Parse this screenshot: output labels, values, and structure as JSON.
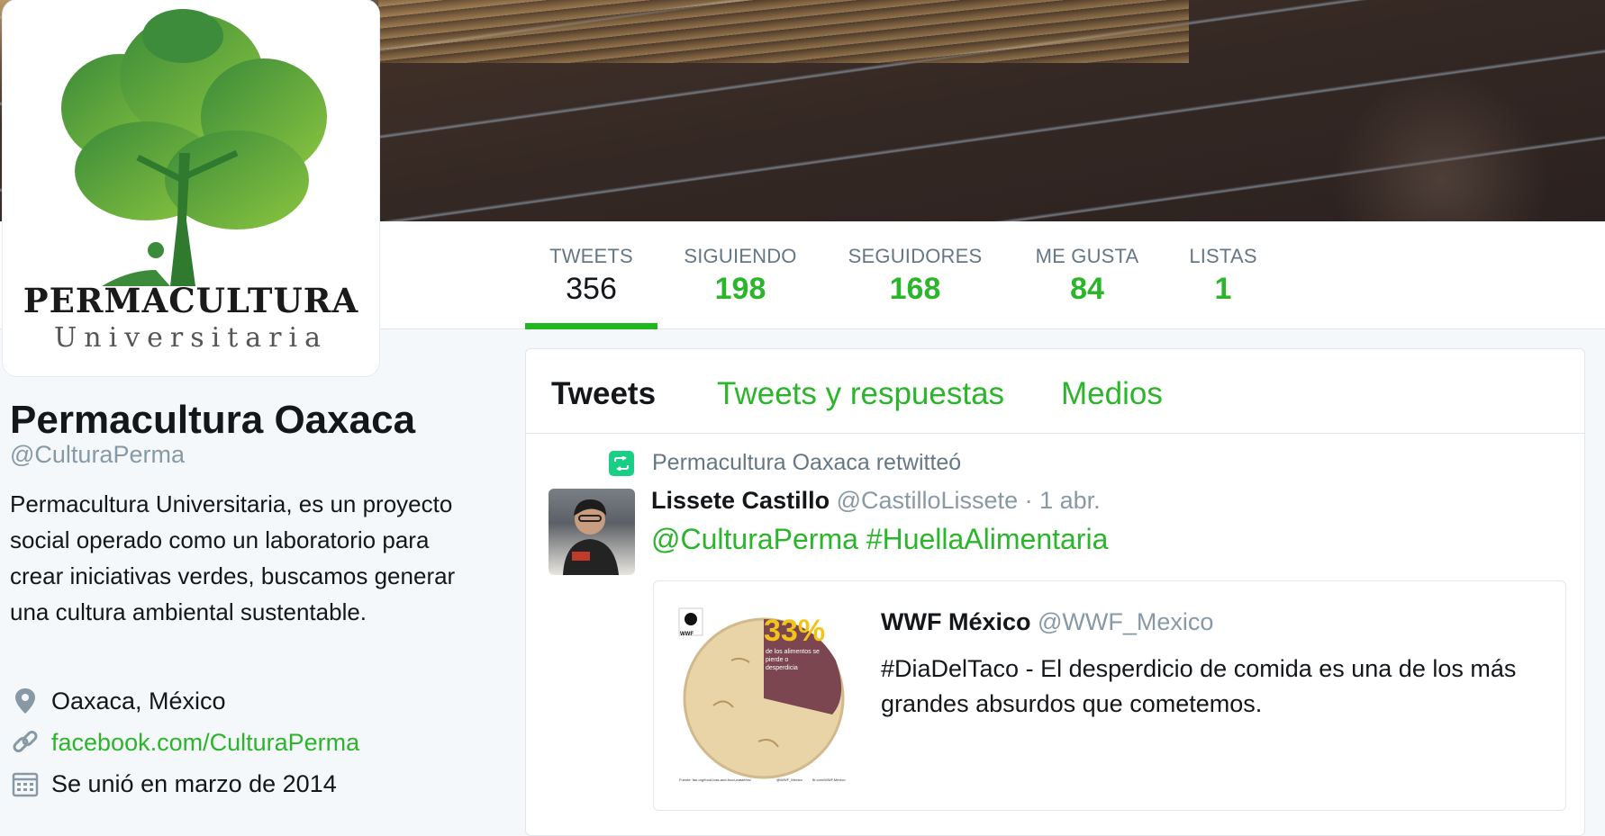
{
  "profile": {
    "logo_title": "PERMACULTURA",
    "logo_subtitle": "Universitaria",
    "name": "Permacultura Oaxaca",
    "handle": "@CulturaPerma",
    "bio": "Permacultura Universitaria, es un proyecto social operado como un laboratorio para crear iniciativas verdes, buscamos generar una cultura ambiental sustentable.",
    "location": "Oaxaca, México",
    "website": "facebook.com/CulturaPerma",
    "joined": "Se unió en marzo de 2014"
  },
  "stats": [
    {
      "label": "TWEETS",
      "value": "356"
    },
    {
      "label": "SIGUIENDO",
      "value": "198"
    },
    {
      "label": "SEGUIDORES",
      "value": "168"
    },
    {
      "label": "ME GUSTA",
      "value": "84"
    },
    {
      "label": "LISTAS",
      "value": "1"
    }
  ],
  "tabs": [
    {
      "label": "Tweets"
    },
    {
      "label": "Tweets y respuestas"
    },
    {
      "label": "Medios"
    }
  ],
  "tweet": {
    "retweet_label": "Permacultura Oaxaca retwitteó",
    "author_name": "Lissete Castillo",
    "author_handle": "@CastilloLissete",
    "date": "· 1 abr.",
    "text": "@CulturaPerma #HuellaAlimentaria",
    "quote": {
      "author_name": "WWF México",
      "author_handle": "@WWF_Mexico",
      "text": "#DiaDelTaco - El desperdicio de comida es una de los más grandes absurdos que cometemos.",
      "image_percent": "33%",
      "image_caption": "de los alimentos se pierde o desperdicia",
      "image_footer_left": "Fuente: fao.org/food-loss-and-food-waste/es/",
      "image_footer_mid": "@WWF_Mexico",
      "image_footer_right": "fb.com/WWF.Mexico",
      "image_logo": "WWF"
    }
  },
  "colors": {
    "accent": "#2ab52a",
    "muted": "#8899a6",
    "retweet": "#19cf86"
  }
}
